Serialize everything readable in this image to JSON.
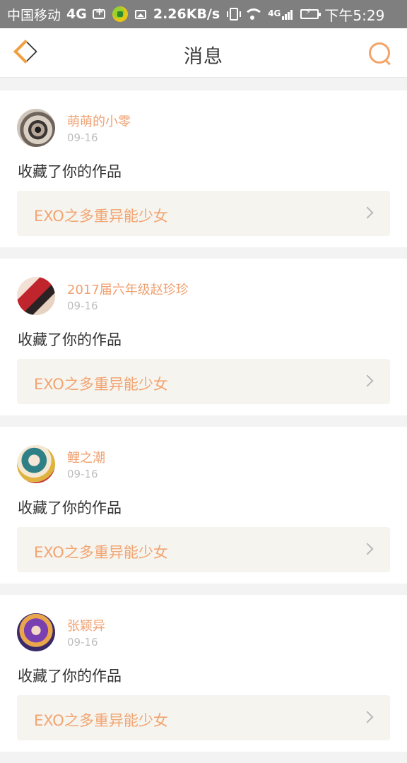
{
  "status_bar": {
    "carrier": "中国移动",
    "network": "4G",
    "speed": "2.26KB/s",
    "signal_label": "4G",
    "time": "下午5:29",
    "icons": [
      "usb-icon",
      "app-icon",
      "image-icon",
      "vibrate-icon",
      "wifi-icon",
      "signal-icon",
      "battery-icon"
    ]
  },
  "header": {
    "title": "消息",
    "back_icon": "chevron-left-icon",
    "search_icon": "search-icon"
  },
  "colors": {
    "accent": "#f0a070",
    "status_bar_bg": "#7f7f7f",
    "card_link_bg": "#f5f4ef"
  },
  "messages": [
    {
      "user": "萌萌的小零",
      "date": "09-16",
      "action": "收藏了你的作品",
      "work": "EXO之多重异能少女"
    },
    {
      "user": "2017届六年级赵珍珍",
      "date": "09-16",
      "action": "收藏了你的作品",
      "work": "EXO之多重异能少女"
    },
    {
      "user": "鲤之潮",
      "date": "09-16",
      "action": "收藏了你的作品",
      "work": "EXO之多重异能少女"
    },
    {
      "user": "张颖异",
      "date": "09-16",
      "action": "收藏了你的作品",
      "work": "EXO之多重异能少女"
    }
  ]
}
